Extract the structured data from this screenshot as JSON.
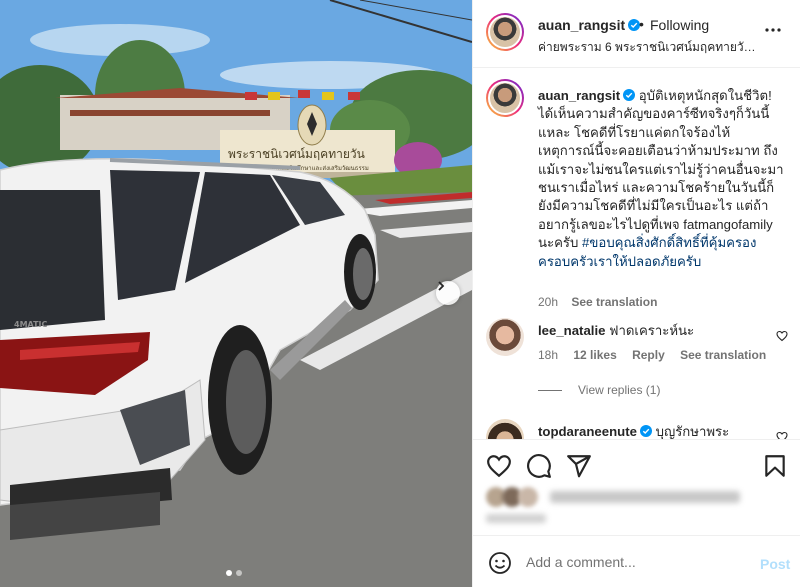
{
  "colors": {
    "accent": "#0095f6",
    "verified": "#0095f6",
    "hashtag": "#00376b",
    "post_disabled": "#b2dffc"
  },
  "photo": {
    "sign_text": "พระราชนิเวศน์มฤคทายวัน",
    "sign_subtext": "มูลนิธิส่งเสริมศึกษาและส่งเสริมวัฒนธรรม",
    "car_badge": "4MATIC",
    "carousel_index": 1,
    "carousel_count": 2
  },
  "header": {
    "username": "auan_rangsit",
    "separator": "•",
    "follow_status": "Following",
    "location": "ค่ายพระราม 6 พระราชนิเวศน์มฤคทายวัน@..."
  },
  "caption": {
    "username": "auan_rangsit",
    "text": "อุบัติเหตุหนักสุดในชีวิต! ได้เห็นความสำคัญของคาร์ซีทจริงๆก็วันนี้แหละ โชคดีที่โรยาแค่ตกใจร้องไห้ เหตุการณ์นี้จะคอยเตือนว่าห้ามประมาท ถึงแม้เราจะไม่ชนใครแต่เราไม่รู้ว่าคนอื่นจะมาชนเราเมื่อไหร่ และความโชคร้ายในวันนี้ก็ยังมีความโชคดีที่ไม่มีใครเป็นอะไร แต่ถ้าอยากรู้เลขอะไรไปดูที่เพจ fatmangofamily นะครับ",
    "hashtag": "#ขอบคุณสิ่งศักดิ์สิทธิ์ที่คุ้มครองครอบครัวเราให้ปลอดภัยครับ",
    "time": "20h",
    "see_translation": "See translation"
  },
  "comments": [
    {
      "username": "lee_natalie",
      "text": "ฟาดเคราะห์นะ",
      "time": "18h",
      "likes": "12 likes",
      "reply": "Reply",
      "see_translation": "See translation",
      "view_replies": "View replies (1)"
    },
    {
      "username": "topdaraneenute",
      "text": "บุญรักษาพระ"
    }
  ],
  "actions": {
    "icons": [
      "heart-icon",
      "comment-icon",
      "share-icon",
      "bookmark-icon"
    ],
    "liked_by_text": "Liked by rebecca_patt and others"
  },
  "add_comment": {
    "placeholder": "Add a comment...",
    "post_label": "Post"
  }
}
